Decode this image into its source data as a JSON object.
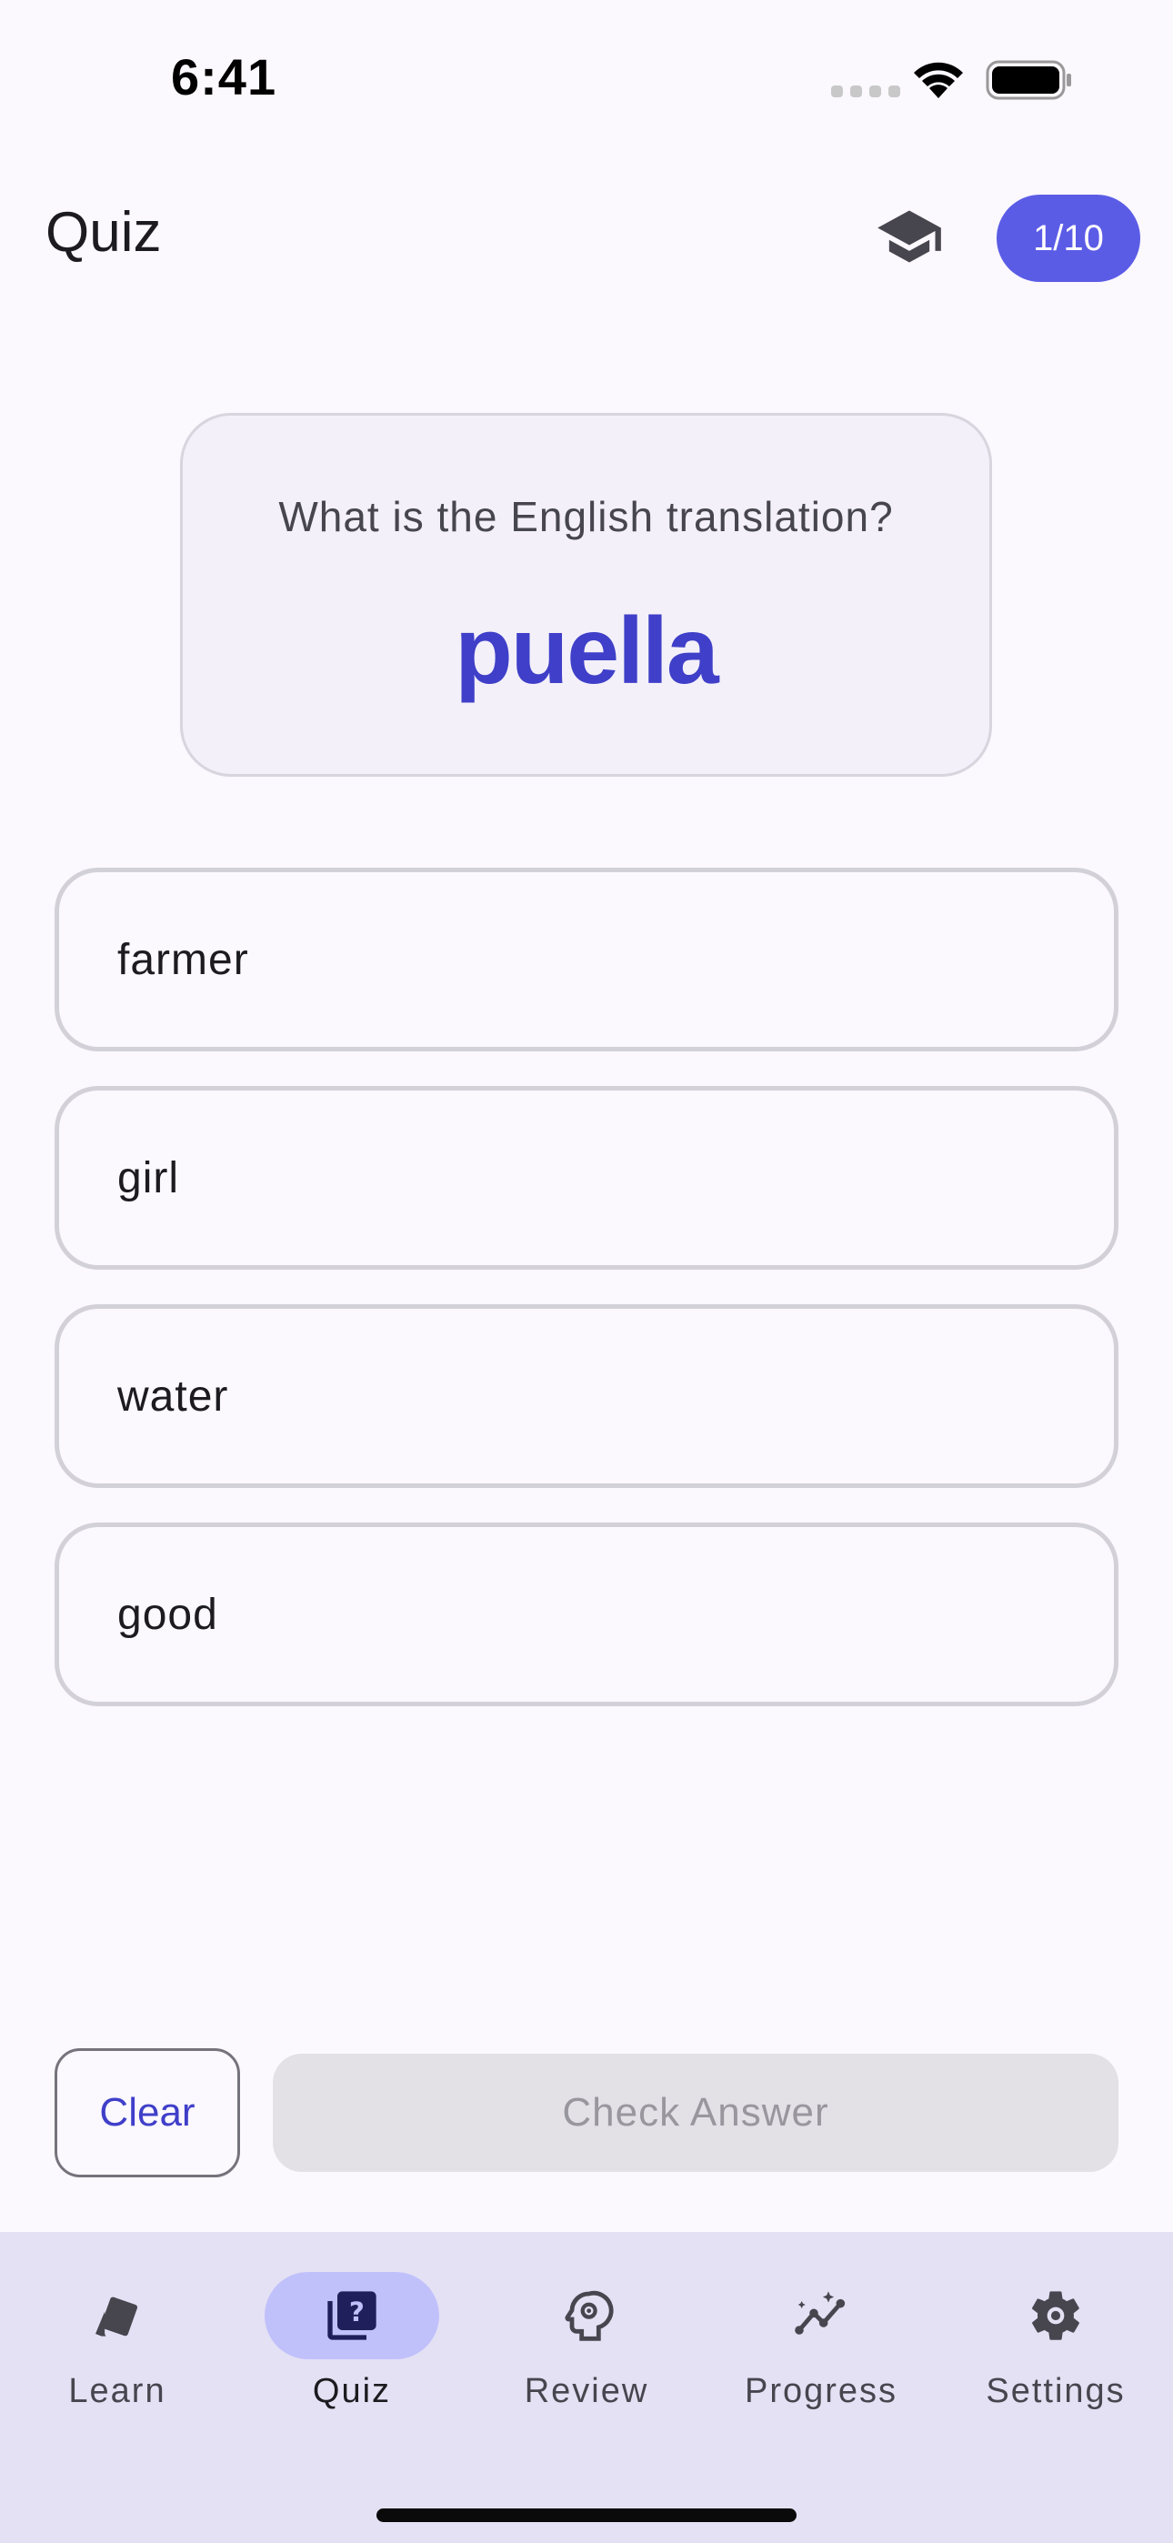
{
  "status_bar": {
    "time": "6:41"
  },
  "app_bar": {
    "title": "Quiz",
    "progress": "1/10"
  },
  "question": {
    "prompt": "What is the English translation?",
    "word": "puella"
  },
  "options": [
    "farmer",
    "girl",
    "water",
    "good"
  ],
  "actions": {
    "clear_label": "Clear",
    "check_label": "Check Answer"
  },
  "nav": {
    "items": [
      {
        "label": "Learn",
        "icon": "cards-icon",
        "active": false
      },
      {
        "label": "Quiz",
        "icon": "quiz-icon",
        "active": true
      },
      {
        "label": "Review",
        "icon": "psychology-icon",
        "active": false
      },
      {
        "label": "Progress",
        "icon": "insights-icon",
        "active": false
      },
      {
        "label": "Settings",
        "icon": "settings-icon",
        "active": false
      }
    ]
  },
  "colors": {
    "accent": "#5b5ce6",
    "accent_text": "#3f3fc9",
    "nav_background": "#e4e1f4",
    "active_indicator": "#c0c1fb"
  }
}
